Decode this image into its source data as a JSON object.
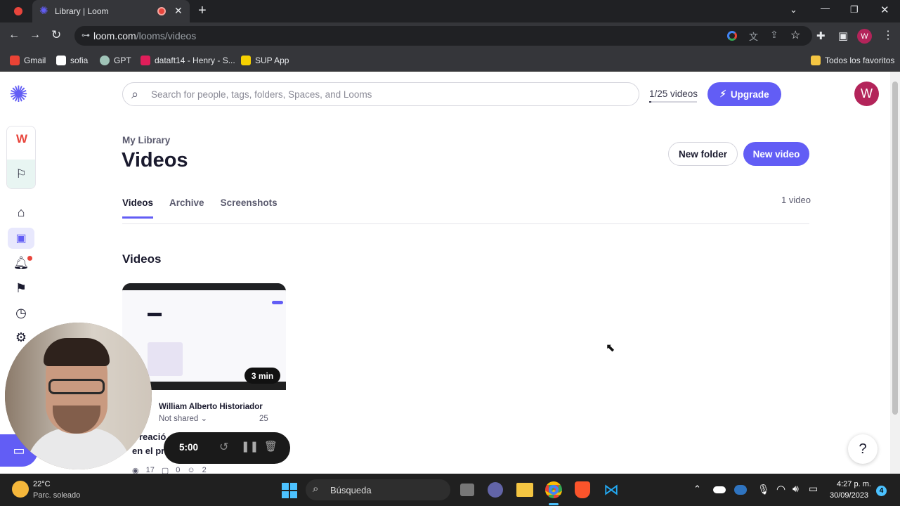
{
  "browser": {
    "tab_title": "Library | Loom",
    "url_domain": "loom.com",
    "url_path": "/looms/videos",
    "profile_initial": "W",
    "bookmarks": [
      {
        "label": "Gmail",
        "color": "#ea4335"
      },
      {
        "label": "sofia",
        "color": "#ffffff"
      },
      {
        "label": "GPT",
        "color": "#a0c4b8"
      },
      {
        "label": "dataft14 - Henry - S...",
        "color": "#e01e5a"
      },
      {
        "label": "SUP App",
        "color": "#f5d000"
      }
    ],
    "all_bookmarks": "Todos los favoritos"
  },
  "app": {
    "search_placeholder": "Search for people, tags, folders, Spaces, and Looms",
    "video_quota": "1/25 videos",
    "upgrade_label": "Upgrade",
    "avatar_initial": "W",
    "workspace_initial": "W",
    "breadcrumb": "My Library",
    "page_title": "Videos",
    "new_folder_label": "New folder",
    "new_video_label": "New video",
    "tabs": [
      "Videos",
      "Archive",
      "Screenshots"
    ],
    "video_count": "1 video",
    "section_title": "Videos",
    "accent": "#625df5"
  },
  "video_card": {
    "duration": "3 min",
    "author": "William Alberto Historiador",
    "share_status": "Not shared",
    "date_fragment": "25",
    "title_line1": "reació",
    "title_line2": "en el pr",
    "views": "17",
    "comments": "0",
    "reactions": "2"
  },
  "recorder": {
    "timer": "5:00"
  },
  "taskbar": {
    "temperature": "22°C",
    "weather": "Parc. soleado",
    "search_label": "Búsqueda",
    "time": "4:27 p. m.",
    "date": "30/09/2023",
    "notif_count": "4"
  }
}
